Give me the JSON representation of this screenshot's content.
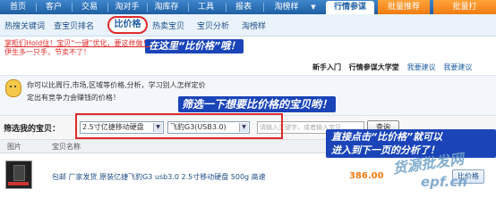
{
  "topnav": {
    "items": [
      "首页",
      "客户",
      "交易",
      "淘对手",
      "淘库存",
      "工具",
      "报表",
      "淘榜样",
      "行情参谋",
      "批量推荐",
      "批量打"
    ],
    "active_index": 8
  },
  "subnav": {
    "items": [
      "热搜关键词",
      "查宝贝排名",
      "比价格",
      "热卖宝贝",
      "宝贝分析",
      "淘榜样"
    ],
    "active_index": 2
  },
  "promo": {
    "line1": "掌柜们Hold住！宝贝“一键”优化，要这样做！",
    "line2": "伊生多一只手，节卖不了！"
  },
  "callouts": {
    "top": "在这里“比价格”哦！",
    "middle": "筛选一下想要比价格的宝贝哟！",
    "bottom_line1": "直接点击“比价格”就可以",
    "bottom_line2": "进入到下一页的分析了！"
  },
  "help_links": {
    "beginner": "新手入门",
    "university": "行情参谋大学堂",
    "suggest": "我要建议",
    "suggest2": "我要建议"
  },
  "info": {
    "line1": "你可以比周行,市场,区域等价格,分析，学习别人怎样定价",
    "line2": "定出有竞争力会赚钱的价格！"
  },
  "filter": {
    "label": "筛选我的宝贝：",
    "select1": "2.5寸亿捷移动硬盘",
    "select2": "飞豹G3(USB3.0)",
    "search_placeholder": "请输入关键字，或者输入宝贝",
    "query_button": "查询"
  },
  "table": {
    "headers": [
      "图片",
      "宝贝名称"
    ],
    "row": {
      "title": "包邮 厂家发货 原装亿捷飞豹G3 usb3.0 2.5寸移动硬盘 500g 高速",
      "price": "386.00",
      "action": "比价格"
    }
  },
  "watermark": {
    "text1": "货源批发网",
    "text2": "epf.cn"
  }
}
